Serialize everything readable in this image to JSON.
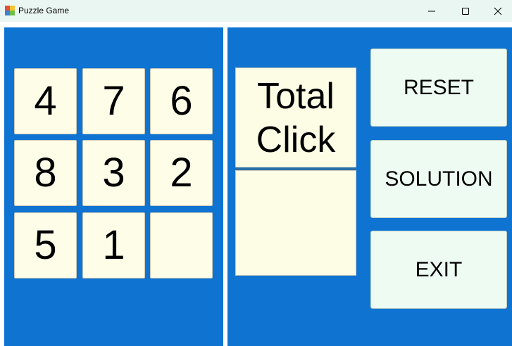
{
  "window": {
    "title": "Puzzle Game"
  },
  "board": {
    "tiles": [
      "4",
      "7",
      "6",
      "8",
      "3",
      "2",
      "5",
      "1",
      ""
    ]
  },
  "counter": {
    "label_line1": "Total",
    "label_line2": "Click",
    "value": ""
  },
  "actions": {
    "reset_label": "RESET",
    "solution_label": "SOLUTION",
    "exit_label": "EXIT"
  },
  "colors": {
    "panel": "#0f73d2",
    "tile": "#fdfde8",
    "button": "#eefbf2",
    "titlebar": "#eaf6f1"
  }
}
